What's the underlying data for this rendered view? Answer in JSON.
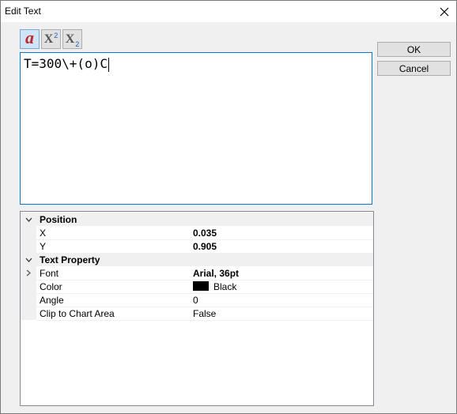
{
  "window": {
    "title": "Edit Text"
  },
  "toolbar": {
    "buttons": [
      "font-style",
      "superscript",
      "subscript"
    ]
  },
  "editor": {
    "text": "T=300\\+(o)C"
  },
  "buttons": {
    "ok": "OK",
    "cancel": "Cancel"
  },
  "grid": {
    "position": {
      "label": "Position",
      "x_label": "X",
      "x_value": "0.035",
      "y_label": "Y",
      "y_value": "0.905"
    },
    "text_property": {
      "label": "Text Property",
      "font_label": "Font",
      "font_value": "Arial, 36pt",
      "color_label": "Color",
      "color_value": "Black",
      "color_hex": "#000000",
      "angle_label": "Angle",
      "angle_value": "0",
      "clip_label": "Clip to Chart Area",
      "clip_value": "False"
    }
  }
}
